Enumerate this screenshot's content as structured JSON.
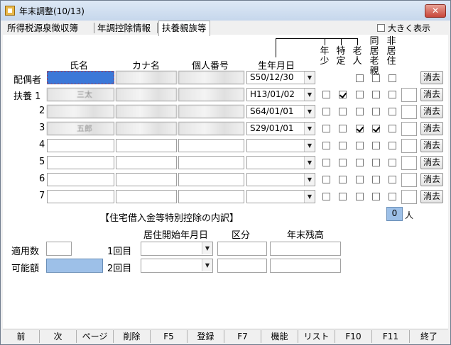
{
  "window": {
    "title": "年末調整(10/13)",
    "close_label": "✕"
  },
  "tabs": [
    "所得税源泉徴収簿",
    "年調控除情報",
    "扶養親族等"
  ],
  "enlarge_label": "大きく表示",
  "headers": {
    "name": "氏名",
    "kana": "カナ名",
    "mynumber": "個人番号",
    "birth": "生年月日",
    "col_young": "年少",
    "col_special": "特定",
    "col_elder": "老人",
    "col_cohabit": "同居老親",
    "col_nonresident": "非居住"
  },
  "rows": [
    {
      "label": "配偶者",
      "name": "",
      "kana": "",
      "mynumber": "",
      "birth": "S50/12/30",
      "checks": [
        null,
        null,
        false,
        false,
        false
      ],
      "delete": "消去",
      "selected": true
    },
    {
      "label": "扶養 1",
      "name": "三太",
      "kana": "",
      "mynumber": "",
      "birth": "H13/01/02",
      "checks": [
        false,
        true,
        false,
        false,
        false
      ],
      "delete": "消去"
    },
    {
      "label": "2",
      "name": "",
      "kana": "",
      "mynumber": "",
      "birth": "S64/01/01",
      "checks": [
        false,
        false,
        false,
        false,
        false
      ],
      "delete": "消去"
    },
    {
      "label": "3",
      "name": "五郎",
      "kana": "",
      "mynumber": "",
      "birth": "S29/01/01",
      "checks": [
        false,
        false,
        true,
        true,
        false
      ],
      "delete": "消去"
    },
    {
      "label": "4",
      "name": "",
      "kana": "",
      "mynumber": "",
      "birth": "",
      "checks": [
        false,
        false,
        false,
        false,
        false
      ],
      "delete": "消去"
    },
    {
      "label": "5",
      "name": "",
      "kana": "",
      "mynumber": "",
      "birth": "",
      "checks": [
        false,
        false,
        false,
        false,
        false
      ],
      "delete": "消去"
    },
    {
      "label": "6",
      "name": "",
      "kana": "",
      "mynumber": "",
      "birth": "",
      "checks": [
        false,
        false,
        false,
        false,
        false
      ],
      "delete": "消去"
    },
    {
      "label": "7",
      "name": "",
      "kana": "",
      "mynumber": "",
      "birth": "",
      "checks": [
        false,
        false,
        false,
        false,
        false
      ],
      "delete": "消去"
    }
  ],
  "count": {
    "value": "0",
    "unit": "人"
  },
  "housing": {
    "title": "【住宅借入金等特別控除の内訳】",
    "col_start": "居住開始年月日",
    "col_type": "区分",
    "col_balance": "年末残高",
    "applied_label": "適用数",
    "possible_label": "可能額",
    "row1": "1回目",
    "row2": "2回目"
  },
  "fkeys": [
    "前",
    "次",
    "ページ",
    "削除",
    "F5",
    "登録",
    "F7",
    "機能",
    "リスト",
    "F10",
    "F11",
    "終了"
  ]
}
